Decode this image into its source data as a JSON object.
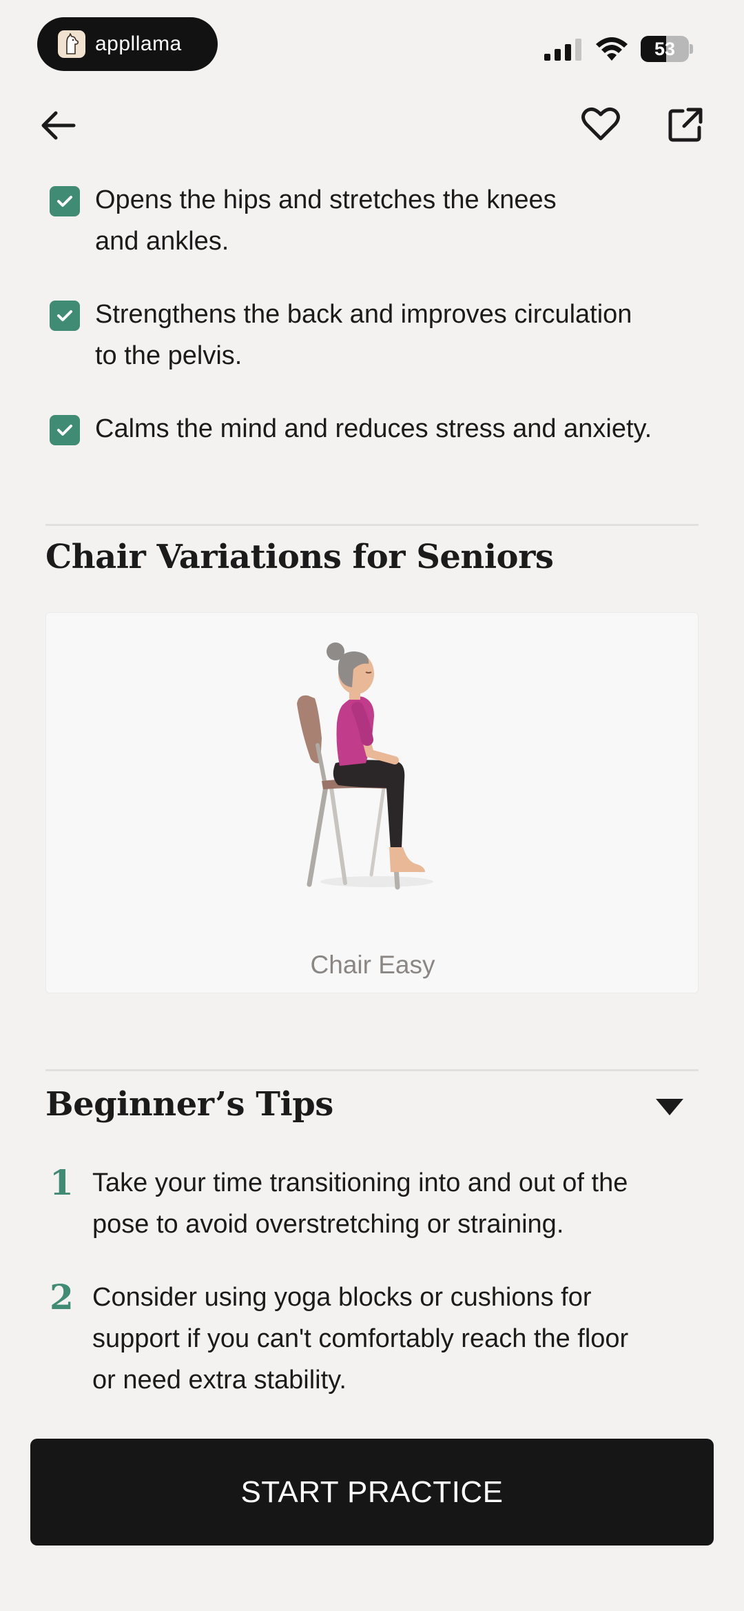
{
  "status_bar": {
    "app_name": "appllama",
    "battery_level": "53",
    "battery_fraction": 0.53
  },
  "nav": {
    "back_icon": "arrow-left-icon",
    "favorite_icon": "heart-outline-icon",
    "share_icon": "external-share-icon"
  },
  "benefits": [
    {
      "line1": "Opens the hips and stretches the knees",
      "line2": "and ankles."
    },
    {
      "line1": "Strengthens the back and improves circulation",
      "line2": "to the pelvis."
    },
    {
      "line1": "Calms the mind and reduces stress and anxiety.",
      "line2": ""
    }
  ],
  "chair_variations": {
    "title": "Chair Variations for Seniors",
    "items": [
      {
        "caption": "Chair Easy"
      }
    ]
  },
  "tips": {
    "title": "Beginner’s Tips",
    "items": [
      {
        "number": "1",
        "line1": "Take your time transitioning into and out of the",
        "line2": "pose to avoid overstretching or straining."
      },
      {
        "number": "2",
        "line1": "Consider using yoga blocks or cushions for",
        "line2": "support if you can't comfortably reach the floor",
        "line3": "or need extra stability."
      }
    ]
  },
  "cta": {
    "label": "START PRACTICE"
  },
  "colors": {
    "background": "#f3f2f1",
    "accent_green": "#3f8b73",
    "button_dark": "#171616",
    "text": "#1c1b1b",
    "caption_gray": "#8a8684"
  }
}
